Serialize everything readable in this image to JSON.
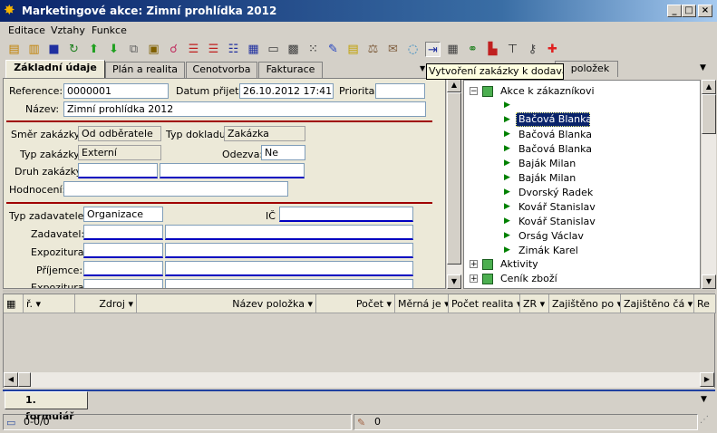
{
  "window": {
    "title": "Marketingové akce: Zimní prohlídka 2012"
  },
  "menu": [
    "Editace",
    "Vztahy",
    "Funkce"
  ],
  "tooltip": "Vytvoření zakázky k dodavateli",
  "tabs": {
    "items": [
      "Základní údaje",
      "Plán a realita",
      "Cenotvorba",
      "Fakturace"
    ],
    "active": "Základní údaje",
    "right_tab_fragment": "položek"
  },
  "form": {
    "reference_label": "Reference:",
    "reference_value": "0000001",
    "datum_label": "Datum přijetí:",
    "datum_value": "26.10.2012 17:41",
    "priorita_label": "Priorita:",
    "priorita_value": "",
    "nazev_label": "Název:",
    "nazev_value": "Zimní prohlídka 2012",
    "smer_label": "Směr zakázky:",
    "smer_value": "Od odběratele",
    "typdokladu_label": "Typ dokladu:",
    "typdokladu_value": "Zakázka",
    "typzakazky_label": "Typ zakázky:",
    "typzakazky_value": "Externí",
    "odezva_label": "Odezva:",
    "odezva_value": "Ne",
    "druh_label": "Druh zakázky:",
    "druh_value": "",
    "hodnoceni_label": "Hodnocení:",
    "hodnoceni_value": "",
    "typzadavatele_label": "Typ zadavatele:",
    "typzadavatele_value": "Organizace",
    "ic_label": "IČ",
    "zadavatel_label": "Zadavatel:",
    "expozitura_label": "Expozitura:",
    "prijemce_label": "Příjemce:",
    "expozitura2_label": "Expozitura:"
  },
  "tree": {
    "root": "Akce k zákazníkovi",
    "children": [
      "",
      "Bačová  Blanka",
      "Bačová Blanka",
      "Bačová Blanka",
      "Baják Milan",
      "Baják Milan",
      "Dvorský Radek",
      "Kovář Stanislav",
      "Kovář Stanislav",
      "Orság  Václav",
      "Zimák Karel"
    ],
    "selected_index": 1,
    "siblings": [
      "Aktivity",
      "Ceník zboží"
    ]
  },
  "grid": {
    "columns": [
      "ř.",
      "Zdroj",
      "Název položka",
      "Počet",
      "Měrná je",
      "Počet realita",
      "ZR",
      "Zajištěno po",
      "Zajištěno čá",
      "Re"
    ]
  },
  "bottom_tab": "1. formulář",
  "status": {
    "left": "0-0/0",
    "right": "0"
  }
}
